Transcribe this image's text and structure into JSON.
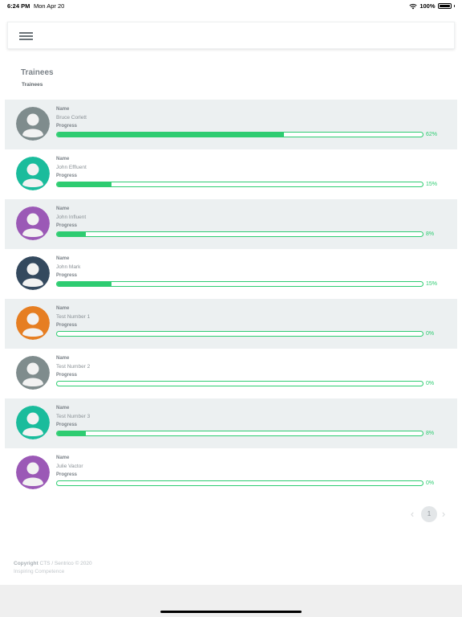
{
  "status_bar": {
    "time": "6:24 PM",
    "date": "Mon Apr 20",
    "battery": "100%"
  },
  "header": {
    "menu_icon": "hamburger-icon"
  },
  "page": {
    "title": "Trainees",
    "breadcrumb": "Trainees"
  },
  "labels": {
    "name": "Name",
    "progress": "Progress"
  },
  "trainees": [
    {
      "name": "Bruce Corlett",
      "progress": 62,
      "progress_text": "62%",
      "avatar_color": "#7f8c8d"
    },
    {
      "name": "John Effluent",
      "progress": 15,
      "progress_text": "15%",
      "avatar_color": "#1abc9c"
    },
    {
      "name": "John Influent",
      "progress": 8,
      "progress_text": "8%",
      "avatar_color": "#9b59b6"
    },
    {
      "name": "John Mark",
      "progress": 15,
      "progress_text": "15%",
      "avatar_color": "#34495e"
    },
    {
      "name": "Test Number 1",
      "progress": 0,
      "progress_text": "0%",
      "avatar_color": "#e67e22"
    },
    {
      "name": "Test Number 2",
      "progress": 0,
      "progress_text": "0%",
      "avatar_color": "#7f8c8d"
    },
    {
      "name": "Test Number 3",
      "progress": 8,
      "progress_text": "8%",
      "avatar_color": "#1abc9c"
    },
    {
      "name": "Julie Vactor",
      "progress": 0,
      "progress_text": "0%",
      "avatar_color": "#9b59b6"
    }
  ],
  "pagination": {
    "current_page": "1",
    "prev_icon": "chevron-left-icon",
    "next_icon": "chevron-right-icon"
  },
  "footer": {
    "copyright_label": "Copyright",
    "copyright_text": "CTS / Sentrico © 2020",
    "tagline": "Inspiring Competence"
  },
  "colors": {
    "accent": "#2ecc71",
    "row_alt": "#ecf0f1"
  }
}
